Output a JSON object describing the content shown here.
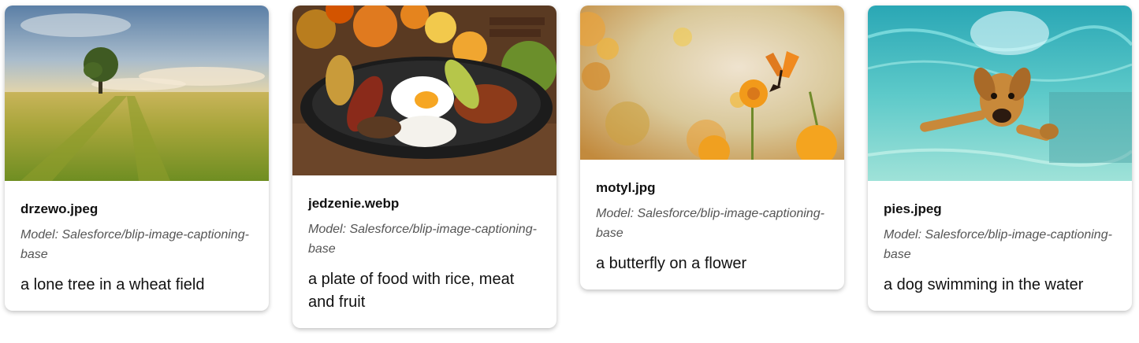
{
  "cards": [
    {
      "filename": "drzewo.jpeg",
      "model": "Model: Salesforce/blip-image-captioning-base",
      "caption": "a lone tree in a wheat field",
      "image_subject": "tree-in-wheat-field"
    },
    {
      "filename": "jedzenie.webp",
      "model": "Model: Salesforce/blip-image-captioning-base",
      "caption": "a plate of food with rice, meat and fruit",
      "image_subject": "plate-of-food"
    },
    {
      "filename": "motyl.jpg",
      "model": "Model: Salesforce/blip-image-captioning-base",
      "caption": "a butterfly on a flower",
      "image_subject": "butterfly-on-flower"
    },
    {
      "filename": "pies.jpeg",
      "model": "Model: Salesforce/blip-image-captioning-base",
      "caption": "a dog swimming in the water",
      "image_subject": "dog-swimming"
    }
  ]
}
